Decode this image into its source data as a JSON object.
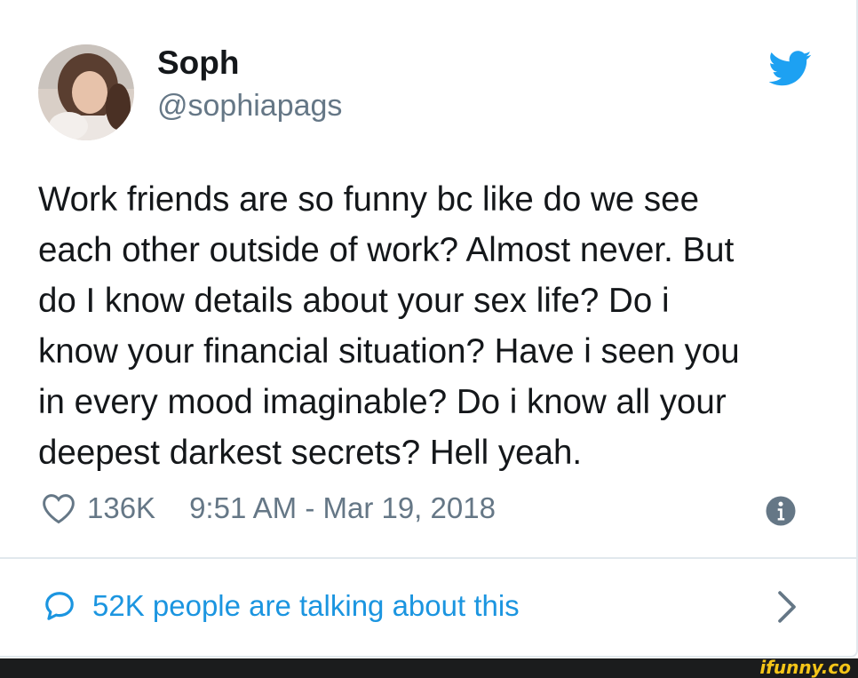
{
  "tweet": {
    "display_name": "Soph",
    "handle": "@sophiapags",
    "text": "Work friends are so funny bc like do we see\neach other outside of work? Almost never. But\ndo I know details about your sex life? Do i\nknow your financial situation? Have i seen you\nin every mood imaginable? Do i know all your\ndeepest darkest secrets? Hell yeah.",
    "likes": "136K",
    "timestamp": "9:51 AM - Mar 19, 2018",
    "talking": "52K people are talking about this"
  },
  "icons": {
    "brand": "twitter-bird-icon",
    "like": "heart-icon",
    "info": "info-icon",
    "reply": "speech-bubble-icon",
    "more": "chevron-right-icon"
  },
  "watermark": "ifunny.co",
  "colors": {
    "text": "#14171a",
    "secondary": "#657786",
    "link": "#1b95e0",
    "twitter_blue": "#1da1f2",
    "border": "#e1e8ed",
    "footer": "#1b1c1d",
    "watermark": "#f5c518"
  }
}
